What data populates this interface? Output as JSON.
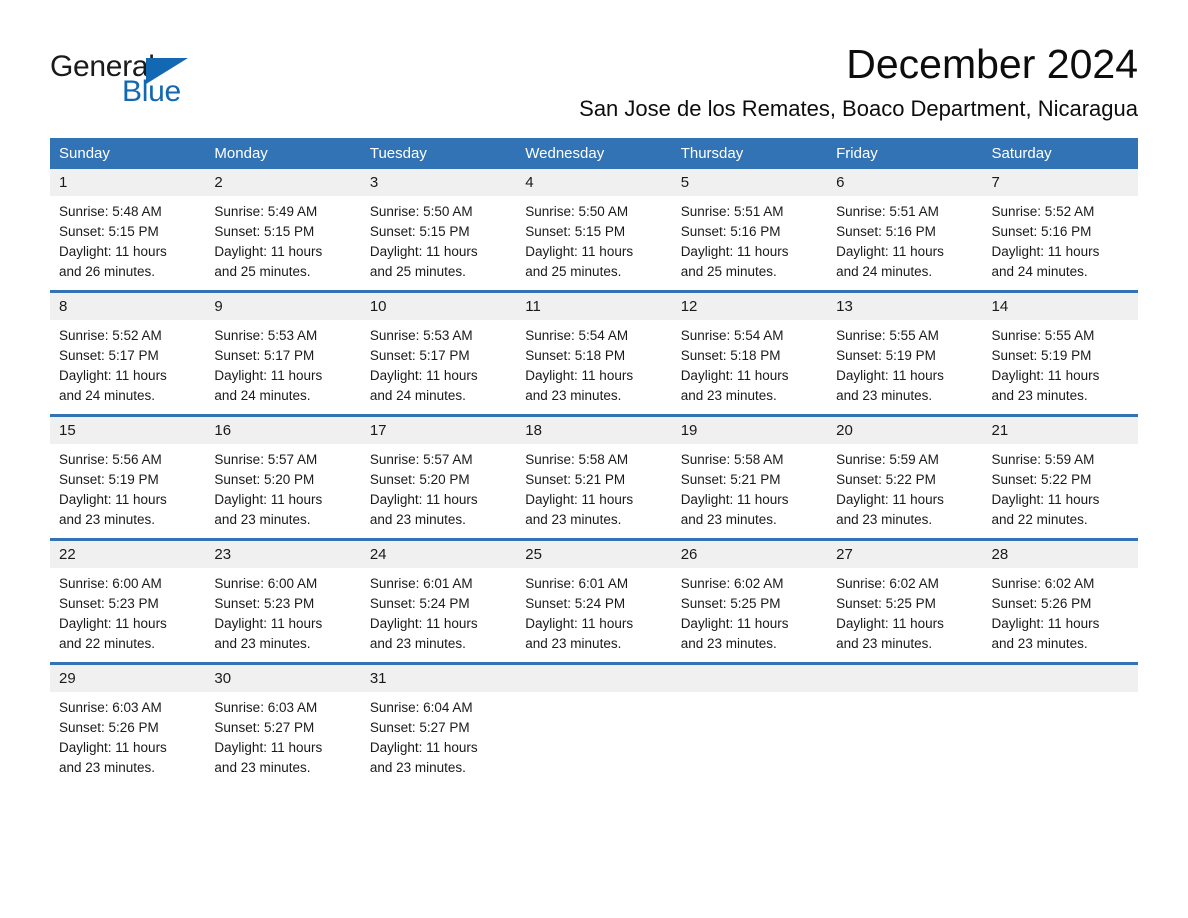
{
  "brand": {
    "word_one": "General",
    "word_two": "Blue",
    "triangle_color": "#1268b3",
    "blue_text_color": "#1268b3",
    "black_text_color": "#1a1a1a"
  },
  "header": {
    "month_title": "December 2024",
    "location": "San Jose de los Remates, Boaco Department, Nicaragua"
  },
  "theme": {
    "header_blue": "#3273b5",
    "date_strip_gray": "#f0f0f0",
    "page_background": "#ffffff",
    "text_color": "#1a1a1a"
  },
  "calendar": {
    "weekday_headers": [
      "Sunday",
      "Monday",
      "Tuesday",
      "Wednesday",
      "Thursday",
      "Friday",
      "Saturday"
    ],
    "weeks": [
      [
        {
          "date": "1",
          "sunrise": "Sunrise: 5:48 AM",
          "sunset": "Sunset: 5:15 PM",
          "daylight_line1": "Daylight: 11 hours",
          "daylight_line2": "and 26 minutes."
        },
        {
          "date": "2",
          "sunrise": "Sunrise: 5:49 AM",
          "sunset": "Sunset: 5:15 PM",
          "daylight_line1": "Daylight: 11 hours",
          "daylight_line2": "and 25 minutes."
        },
        {
          "date": "3",
          "sunrise": "Sunrise: 5:50 AM",
          "sunset": "Sunset: 5:15 PM",
          "daylight_line1": "Daylight: 11 hours",
          "daylight_line2": "and 25 minutes."
        },
        {
          "date": "4",
          "sunrise": "Sunrise: 5:50 AM",
          "sunset": "Sunset: 5:15 PM",
          "daylight_line1": "Daylight: 11 hours",
          "daylight_line2": "and 25 minutes."
        },
        {
          "date": "5",
          "sunrise": "Sunrise: 5:51 AM",
          "sunset": "Sunset: 5:16 PM",
          "daylight_line1": "Daylight: 11 hours",
          "daylight_line2": "and 25 minutes."
        },
        {
          "date": "6",
          "sunrise": "Sunrise: 5:51 AM",
          "sunset": "Sunset: 5:16 PM",
          "daylight_line1": "Daylight: 11 hours",
          "daylight_line2": "and 24 minutes."
        },
        {
          "date": "7",
          "sunrise": "Sunrise: 5:52 AM",
          "sunset": "Sunset: 5:16 PM",
          "daylight_line1": "Daylight: 11 hours",
          "daylight_line2": "and 24 minutes."
        }
      ],
      [
        {
          "date": "8",
          "sunrise": "Sunrise: 5:52 AM",
          "sunset": "Sunset: 5:17 PM",
          "daylight_line1": "Daylight: 11 hours",
          "daylight_line2": "and 24 minutes."
        },
        {
          "date": "9",
          "sunrise": "Sunrise: 5:53 AM",
          "sunset": "Sunset: 5:17 PM",
          "daylight_line1": "Daylight: 11 hours",
          "daylight_line2": "and 24 minutes."
        },
        {
          "date": "10",
          "sunrise": "Sunrise: 5:53 AM",
          "sunset": "Sunset: 5:17 PM",
          "daylight_line1": "Daylight: 11 hours",
          "daylight_line2": "and 24 minutes."
        },
        {
          "date": "11",
          "sunrise": "Sunrise: 5:54 AM",
          "sunset": "Sunset: 5:18 PM",
          "daylight_line1": "Daylight: 11 hours",
          "daylight_line2": "and 23 minutes."
        },
        {
          "date": "12",
          "sunrise": "Sunrise: 5:54 AM",
          "sunset": "Sunset: 5:18 PM",
          "daylight_line1": "Daylight: 11 hours",
          "daylight_line2": "and 23 minutes."
        },
        {
          "date": "13",
          "sunrise": "Sunrise: 5:55 AM",
          "sunset": "Sunset: 5:19 PM",
          "daylight_line1": "Daylight: 11 hours",
          "daylight_line2": "and 23 minutes."
        },
        {
          "date": "14",
          "sunrise": "Sunrise: 5:55 AM",
          "sunset": "Sunset: 5:19 PM",
          "daylight_line1": "Daylight: 11 hours",
          "daylight_line2": "and 23 minutes."
        }
      ],
      [
        {
          "date": "15",
          "sunrise": "Sunrise: 5:56 AM",
          "sunset": "Sunset: 5:19 PM",
          "daylight_line1": "Daylight: 11 hours",
          "daylight_line2": "and 23 minutes."
        },
        {
          "date": "16",
          "sunrise": "Sunrise: 5:57 AM",
          "sunset": "Sunset: 5:20 PM",
          "daylight_line1": "Daylight: 11 hours",
          "daylight_line2": "and 23 minutes."
        },
        {
          "date": "17",
          "sunrise": "Sunrise: 5:57 AM",
          "sunset": "Sunset: 5:20 PM",
          "daylight_line1": "Daylight: 11 hours",
          "daylight_line2": "and 23 minutes."
        },
        {
          "date": "18",
          "sunrise": "Sunrise: 5:58 AM",
          "sunset": "Sunset: 5:21 PM",
          "daylight_line1": "Daylight: 11 hours",
          "daylight_line2": "and 23 minutes."
        },
        {
          "date": "19",
          "sunrise": "Sunrise: 5:58 AM",
          "sunset": "Sunset: 5:21 PM",
          "daylight_line1": "Daylight: 11 hours",
          "daylight_line2": "and 23 minutes."
        },
        {
          "date": "20",
          "sunrise": "Sunrise: 5:59 AM",
          "sunset": "Sunset: 5:22 PM",
          "daylight_line1": "Daylight: 11 hours",
          "daylight_line2": "and 23 minutes."
        },
        {
          "date": "21",
          "sunrise": "Sunrise: 5:59 AM",
          "sunset": "Sunset: 5:22 PM",
          "daylight_line1": "Daylight: 11 hours",
          "daylight_line2": "and 22 minutes."
        }
      ],
      [
        {
          "date": "22",
          "sunrise": "Sunrise: 6:00 AM",
          "sunset": "Sunset: 5:23 PM",
          "daylight_line1": "Daylight: 11 hours",
          "daylight_line2": "and 22 minutes."
        },
        {
          "date": "23",
          "sunrise": "Sunrise: 6:00 AM",
          "sunset": "Sunset: 5:23 PM",
          "daylight_line1": "Daylight: 11 hours",
          "daylight_line2": "and 23 minutes."
        },
        {
          "date": "24",
          "sunrise": "Sunrise: 6:01 AM",
          "sunset": "Sunset: 5:24 PM",
          "daylight_line1": "Daylight: 11 hours",
          "daylight_line2": "and 23 minutes."
        },
        {
          "date": "25",
          "sunrise": "Sunrise: 6:01 AM",
          "sunset": "Sunset: 5:24 PM",
          "daylight_line1": "Daylight: 11 hours",
          "daylight_line2": "and 23 minutes."
        },
        {
          "date": "26",
          "sunrise": "Sunrise: 6:02 AM",
          "sunset": "Sunset: 5:25 PM",
          "daylight_line1": "Daylight: 11 hours",
          "daylight_line2": "and 23 minutes."
        },
        {
          "date": "27",
          "sunrise": "Sunrise: 6:02 AM",
          "sunset": "Sunset: 5:25 PM",
          "daylight_line1": "Daylight: 11 hours",
          "daylight_line2": "and 23 minutes."
        },
        {
          "date": "28",
          "sunrise": "Sunrise: 6:02 AM",
          "sunset": "Sunset: 5:26 PM",
          "daylight_line1": "Daylight: 11 hours",
          "daylight_line2": "and 23 minutes."
        }
      ],
      [
        {
          "date": "29",
          "sunrise": "Sunrise: 6:03 AM",
          "sunset": "Sunset: 5:26 PM",
          "daylight_line1": "Daylight: 11 hours",
          "daylight_line2": "and 23 minutes."
        },
        {
          "date": "30",
          "sunrise": "Sunrise: 6:03 AM",
          "sunset": "Sunset: 5:27 PM",
          "daylight_line1": "Daylight: 11 hours",
          "daylight_line2": "and 23 minutes."
        },
        {
          "date": "31",
          "sunrise": "Sunrise: 6:04 AM",
          "sunset": "Sunset: 5:27 PM",
          "daylight_line1": "Daylight: 11 hours",
          "daylight_line2": "and 23 minutes."
        },
        {
          "date": "",
          "sunrise": "",
          "sunset": "",
          "daylight_line1": "",
          "daylight_line2": ""
        },
        {
          "date": "",
          "sunrise": "",
          "sunset": "",
          "daylight_line1": "",
          "daylight_line2": ""
        },
        {
          "date": "",
          "sunrise": "",
          "sunset": "",
          "daylight_line1": "",
          "daylight_line2": ""
        },
        {
          "date": "",
          "sunrise": "",
          "sunset": "",
          "daylight_line1": "",
          "daylight_line2": ""
        }
      ]
    ]
  }
}
